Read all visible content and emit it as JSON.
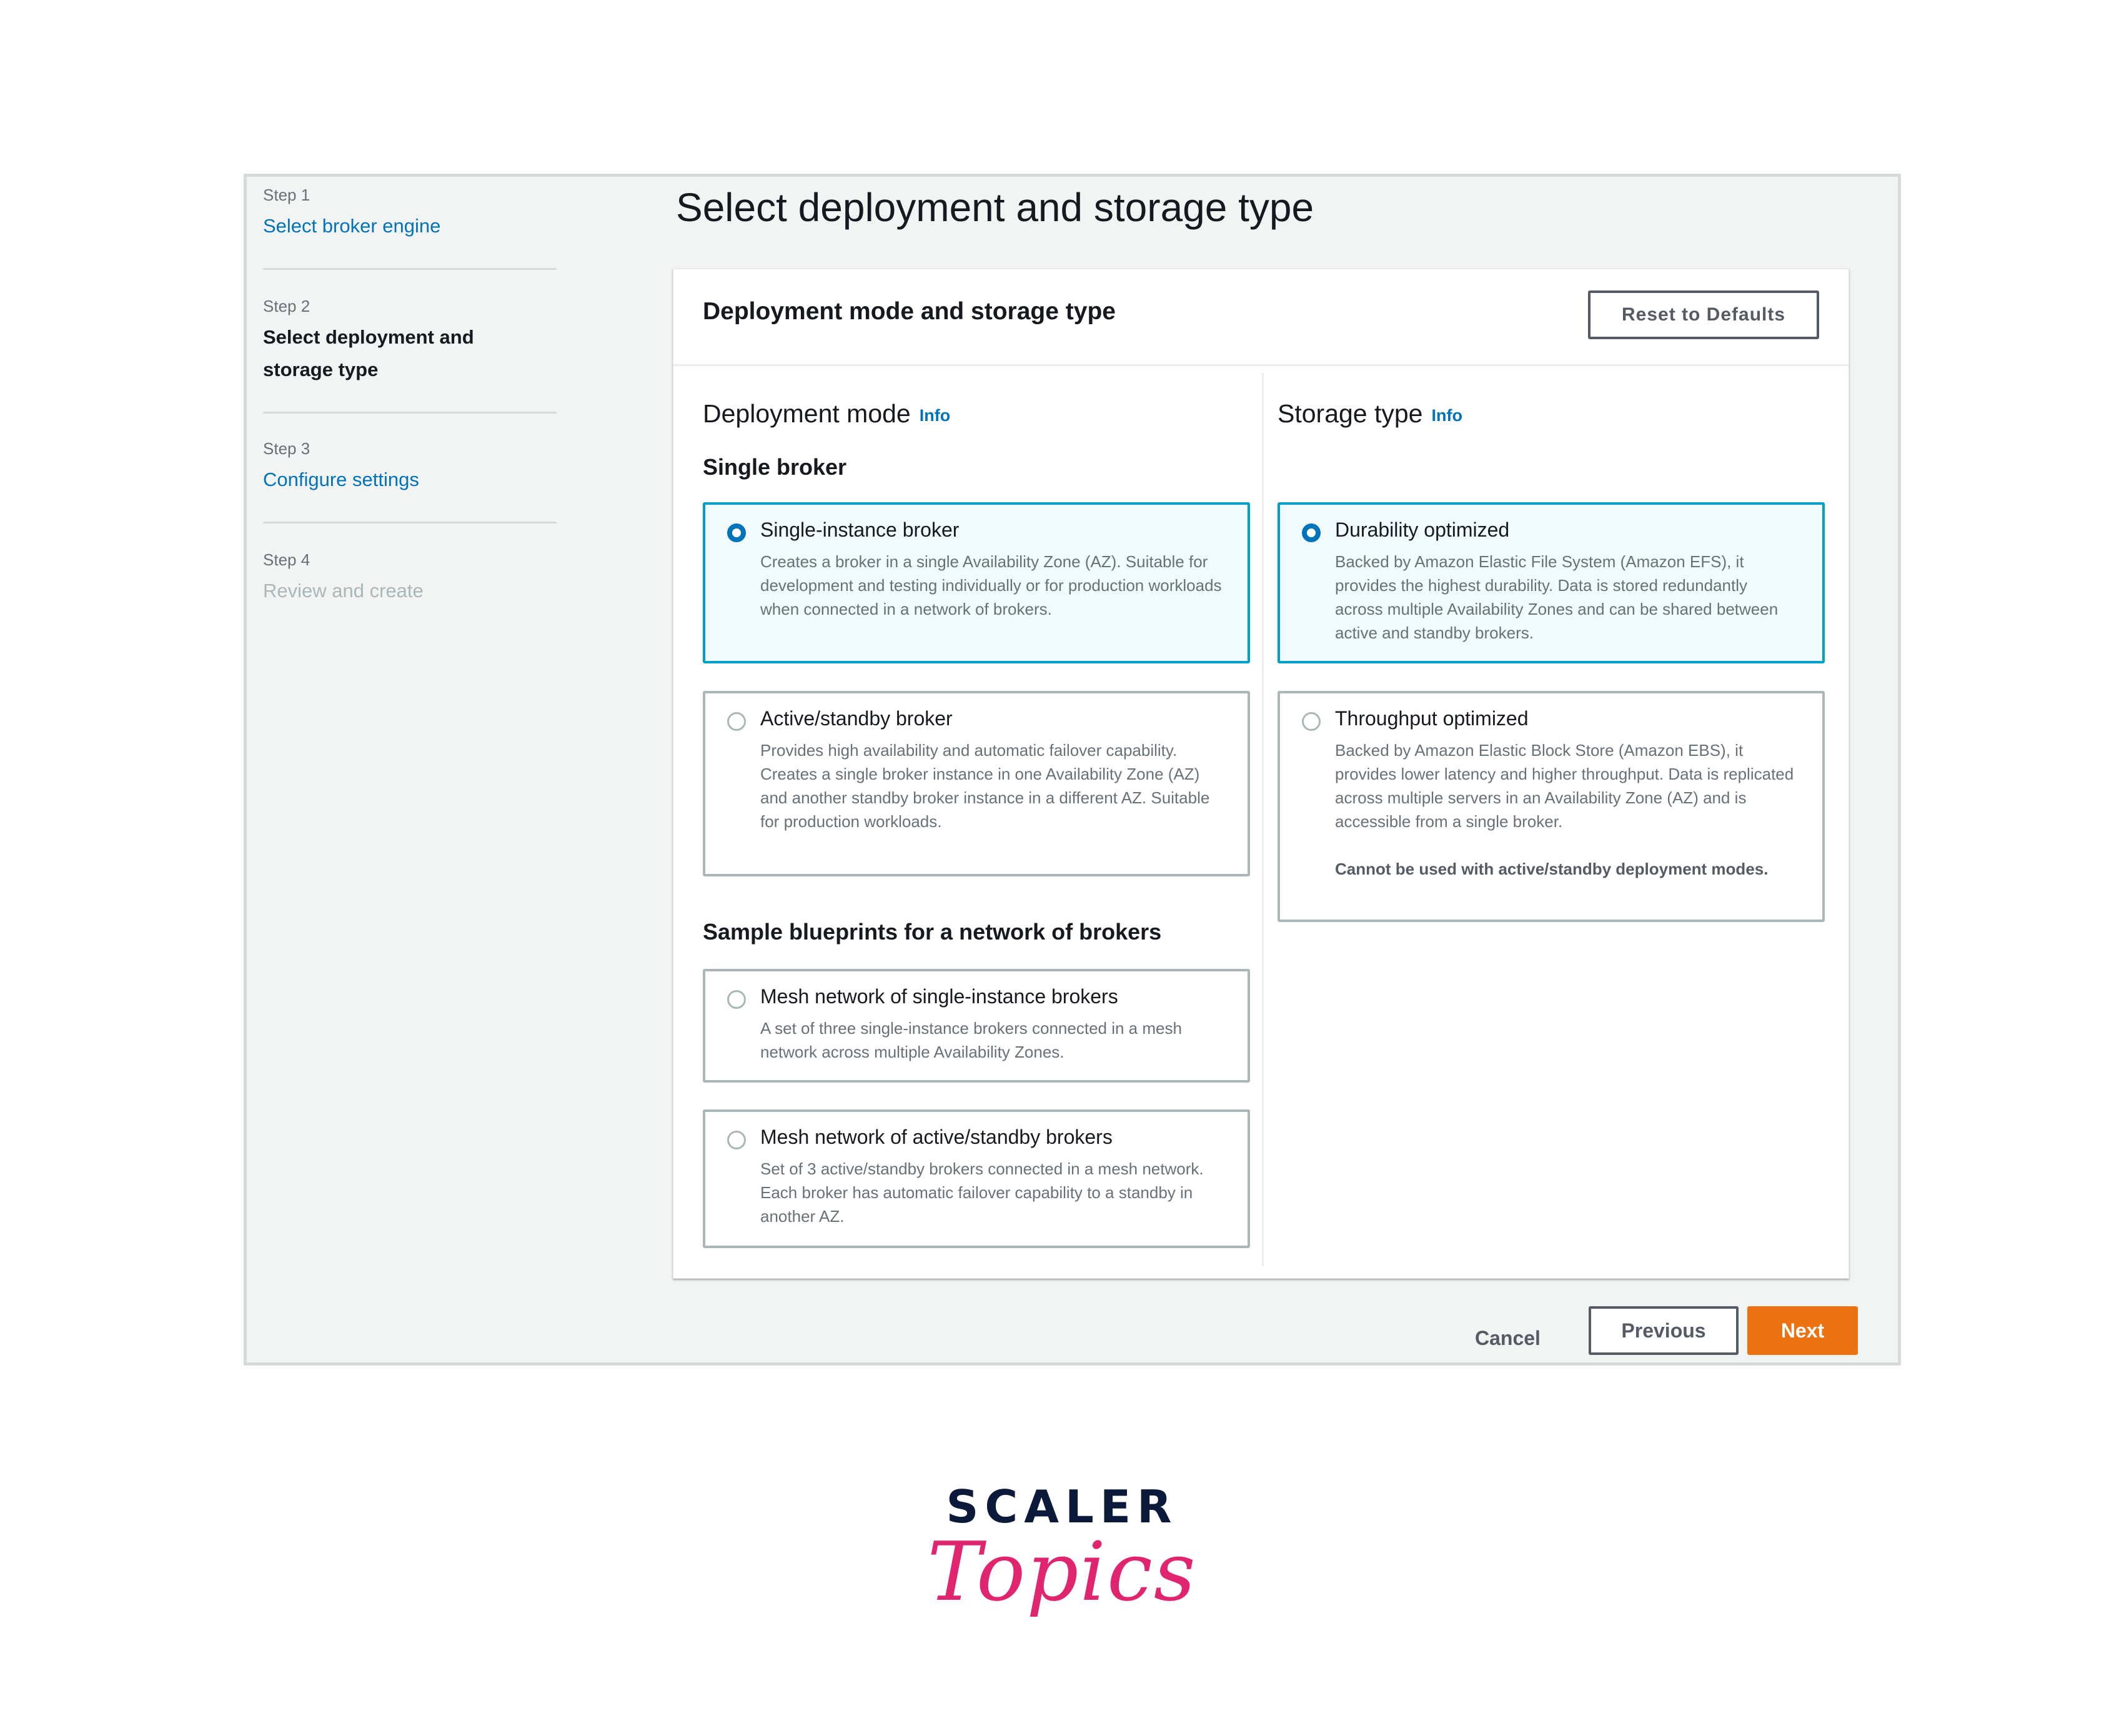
{
  "steps": [
    {
      "num": "Step 1",
      "title": "Select broker engine"
    },
    {
      "num": "Step 2",
      "title": "Select deployment and storage type"
    },
    {
      "num": "Step 3",
      "title": "Configure settings"
    },
    {
      "num": "Step 4",
      "title": "Review and create"
    }
  ],
  "page_title": "Select deployment and storage type",
  "panel": {
    "title": "Deployment mode and storage type",
    "reset_label": "Reset to Defaults"
  },
  "deployment": {
    "heading": "Deployment mode",
    "info": "Info",
    "single_heading": "Single broker",
    "options": [
      {
        "label": "Single-instance broker",
        "desc": "Creates a broker in a single Availability Zone (AZ). Suitable for development and testing individually or for production workloads when connected in a network of brokers.",
        "selected": true
      },
      {
        "label": "Active/standby broker",
        "desc": "Provides high availability and automatic failover capability. Creates a single broker instance in one Availability Zone (AZ) and another standby broker instance in a different AZ. Suitable for production workloads.",
        "selected": false
      }
    ],
    "blueprints_heading": "Sample blueprints for a network of brokers",
    "blueprints": [
      {
        "label": "Mesh network of single-instance brokers",
        "desc": "A set of three single-instance brokers connected in a mesh network across multiple Availability Zones.",
        "selected": false
      },
      {
        "label": "Mesh network of active/standby brokers",
        "desc": "Set of 3 active/standby brokers connected in a mesh network. Each broker has automatic failover capability to a standby in another AZ.",
        "selected": false
      }
    ]
  },
  "storage": {
    "heading": "Storage type",
    "info": "Info",
    "options": [
      {
        "label": "Durability optimized",
        "desc": "Backed by Amazon Elastic File System (Amazon EFS), it provides the highest durability. Data is stored redundantly across multiple Availability Zones and can be shared between active and standby brokers.",
        "selected": true
      },
      {
        "label": "Throughput optimized",
        "desc": "Backed by Amazon Elastic Block Store (Amazon EBS), it provides lower latency and higher throughput. Data is replicated across multiple servers in an Availability Zone (AZ) and is accessible from a single broker.",
        "note": "Cannot be used with active/standby deployment modes.",
        "selected": false
      }
    ]
  },
  "footer": {
    "cancel": "Cancel",
    "previous": "Previous",
    "next": "Next"
  },
  "brand": {
    "top": "SCALER",
    "bottom": "Topics"
  },
  "colors": {
    "link": "#0073bb",
    "primary_button": "#ec7211",
    "selected_border": "#00a1c9",
    "selected_bg": "#f1faff",
    "brand_pink": "#e1246f",
    "brand_navy": "#0b1a3a"
  }
}
